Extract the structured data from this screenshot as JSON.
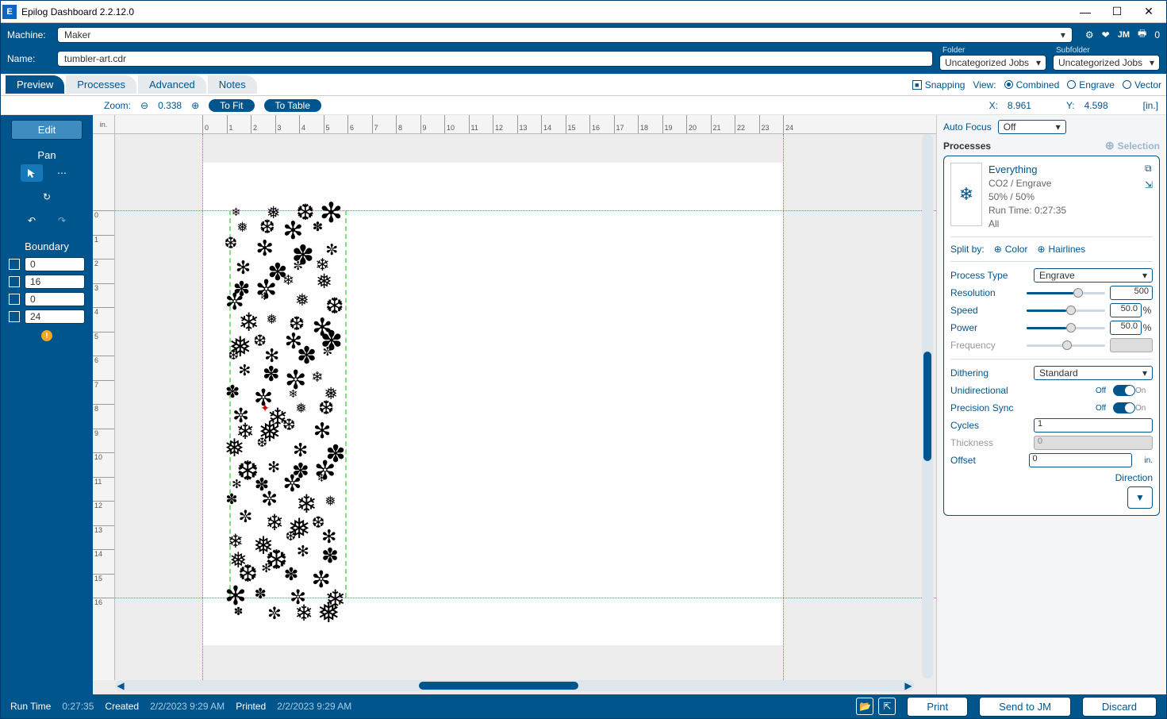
{
  "app": {
    "title": "Epilog Dashboard 2.2.12.0",
    "icon_letter": "E"
  },
  "topbar": {
    "machine_label": "Machine:",
    "machine_value": "Maker",
    "name_label": "Name:",
    "name_value": "tumbler-art.cdr",
    "folder_label": "Folder",
    "folder_value": "Uncategorized Jobs",
    "subfolder_label": "Subfolder",
    "subfolder_value": "Uncategorized Jobs",
    "top_print_count": "0"
  },
  "tabs": {
    "preview": "Preview",
    "processes": "Processes",
    "advanced": "Advanced",
    "notes": "Notes"
  },
  "tabright": {
    "snapping": "Snapping",
    "view_label": "View:",
    "combined": "Combined",
    "engrave": "Engrave",
    "vector": "Vector"
  },
  "zoombar": {
    "zoom_label": "Zoom:",
    "zoom_value": "0.338",
    "tofit": "To Fit",
    "totable": "To Table",
    "x_label": "X:",
    "x_value": "8.961",
    "y_label": "Y:",
    "y_value": "4.598",
    "unit": "[in.]"
  },
  "sidebar": {
    "edit": "Edit",
    "pan": "Pan",
    "boundary_label": "Boundary",
    "boundary": {
      "top": "0",
      "height": "16",
      "left": "0",
      "width": "24"
    }
  },
  "ruler": {
    "unit": "in."
  },
  "right": {
    "autofocus_label": "Auto Focus",
    "autofocus_value": "Off",
    "processes_label": "Processes",
    "selection": "Selection",
    "process": {
      "name": "Everything",
      "line1": "CO2 / Engrave",
      "line2": "50% / 50%",
      "runtime": "Run Time: 0:27:35",
      "scope": "All"
    },
    "splitby": {
      "label": "Split by:",
      "color": "Color",
      "hairlines": "Hairlines"
    },
    "process_type": {
      "label": "Process Type",
      "value": "Engrave"
    },
    "resolution": {
      "label": "Resolution",
      "value": "500"
    },
    "speed": {
      "label": "Speed",
      "value": "50.0",
      "unit": "%"
    },
    "power": {
      "label": "Power",
      "value": "50.0",
      "unit": "%"
    },
    "frequency": {
      "label": "Frequency",
      "value": ""
    },
    "dithering": {
      "label": "Dithering",
      "value": "Standard"
    },
    "unidirectional": {
      "label": "Unidirectional",
      "state": "Off",
      "on_label": "On"
    },
    "precision_sync": {
      "label": "Precision Sync",
      "state": "Off",
      "on_label": "On"
    },
    "cycles": {
      "label": "Cycles",
      "value": "1"
    },
    "thickness": {
      "label": "Thickness",
      "value": "0"
    },
    "offset": {
      "label": "Offset",
      "value": "0",
      "unit": "in."
    },
    "direction": "Direction"
  },
  "status": {
    "runtime_label": "Run Time",
    "runtime_value": "0:27:35",
    "created_label": "Created",
    "created_value": "2/2/2023 9:29 AM",
    "printed_label": "Printed",
    "printed_value": "2/2/2023 9:29 AM",
    "print": "Print",
    "send_jm": "Send to JM",
    "discard": "Discard"
  }
}
